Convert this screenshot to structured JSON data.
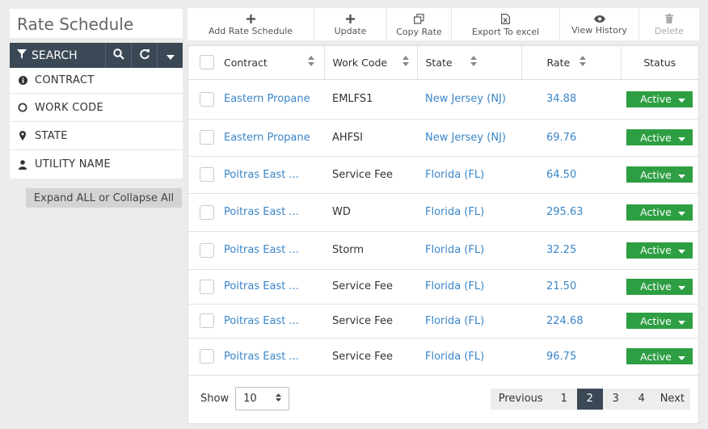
{
  "page": {
    "title": "Rate Schedule"
  },
  "search": {
    "label": "SEARCH"
  },
  "filters": [
    {
      "label": "CONTRACT",
      "icon": "info-icon"
    },
    {
      "label": "WORK CODE",
      "icon": "circle-icon"
    },
    {
      "label": "STATE",
      "icon": "map-pin-icon"
    },
    {
      "label": "UTILITY NAME",
      "icon": "user-icon"
    }
  ],
  "expand_label": "Expand ALL or Collapse All",
  "toolbar": {
    "add": "Add Rate Schedule",
    "update": "Update",
    "copy": "Copy Rate",
    "export": "Export To excel",
    "history": "View History",
    "delete": "Delete"
  },
  "table": {
    "headers": [
      "Contract",
      "Work Code",
      "State",
      "Rate",
      "Status"
    ],
    "rows": [
      {
        "contract": "Eastern Propane",
        "work_code": "EMLFS1",
        "state": "New Jersey (NJ)",
        "rate": "34.88",
        "status": "Active"
      },
      {
        "contract": "Eastern Propane",
        "work_code": "AHFSI",
        "state": "New Jersey (NJ)",
        "rate": "69.76",
        "status": "Active"
      },
      {
        "contract": "Poitras East ...",
        "work_code": "Service Fee",
        "state": "Florida (FL)",
        "rate": "64.50",
        "status": "Active"
      },
      {
        "contract": "Poitras East ...",
        "work_code": "WD",
        "state": "Florida (FL)",
        "rate": "295.63",
        "status": "Active"
      },
      {
        "contract": "Poitras East ...",
        "work_code": "Storm",
        "state": "Florida (FL)",
        "rate": "32.25",
        "status": "Active"
      },
      {
        "contract": "Poitras East ...",
        "work_code": "Service Fee",
        "state": "Florida (FL)",
        "rate": "21.50",
        "status": "Active"
      },
      {
        "contract": "Poitras East ...",
        "work_code": "Service Fee",
        "state": "Florida (FL)",
        "rate": "224.68",
        "status": "Active"
      },
      {
        "contract": "Poitras East ...",
        "work_code": "Service Fee",
        "state": "Florida (FL)",
        "rate": "96.75",
        "status": "Active"
      }
    ]
  },
  "footer": {
    "show_label": "Show",
    "page_size": "10",
    "pagination": {
      "previous": "Previous",
      "pages": [
        "1",
        "2",
        "3",
        "4"
      ],
      "current": "2",
      "next": "Next"
    }
  },
  "colors": {
    "accent": "#3b4856",
    "link": "#3b86c9",
    "status_active": "#2e9e43"
  }
}
